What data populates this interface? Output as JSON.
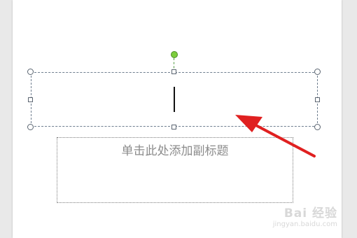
{
  "slide": {
    "subtitle_placeholder": "单击此处添加副标题"
  },
  "annotation": {
    "arrow_color": "#e02020"
  },
  "watermark": {
    "brand": "Bai 经验",
    "domain": "jingyan.baidu.com"
  }
}
